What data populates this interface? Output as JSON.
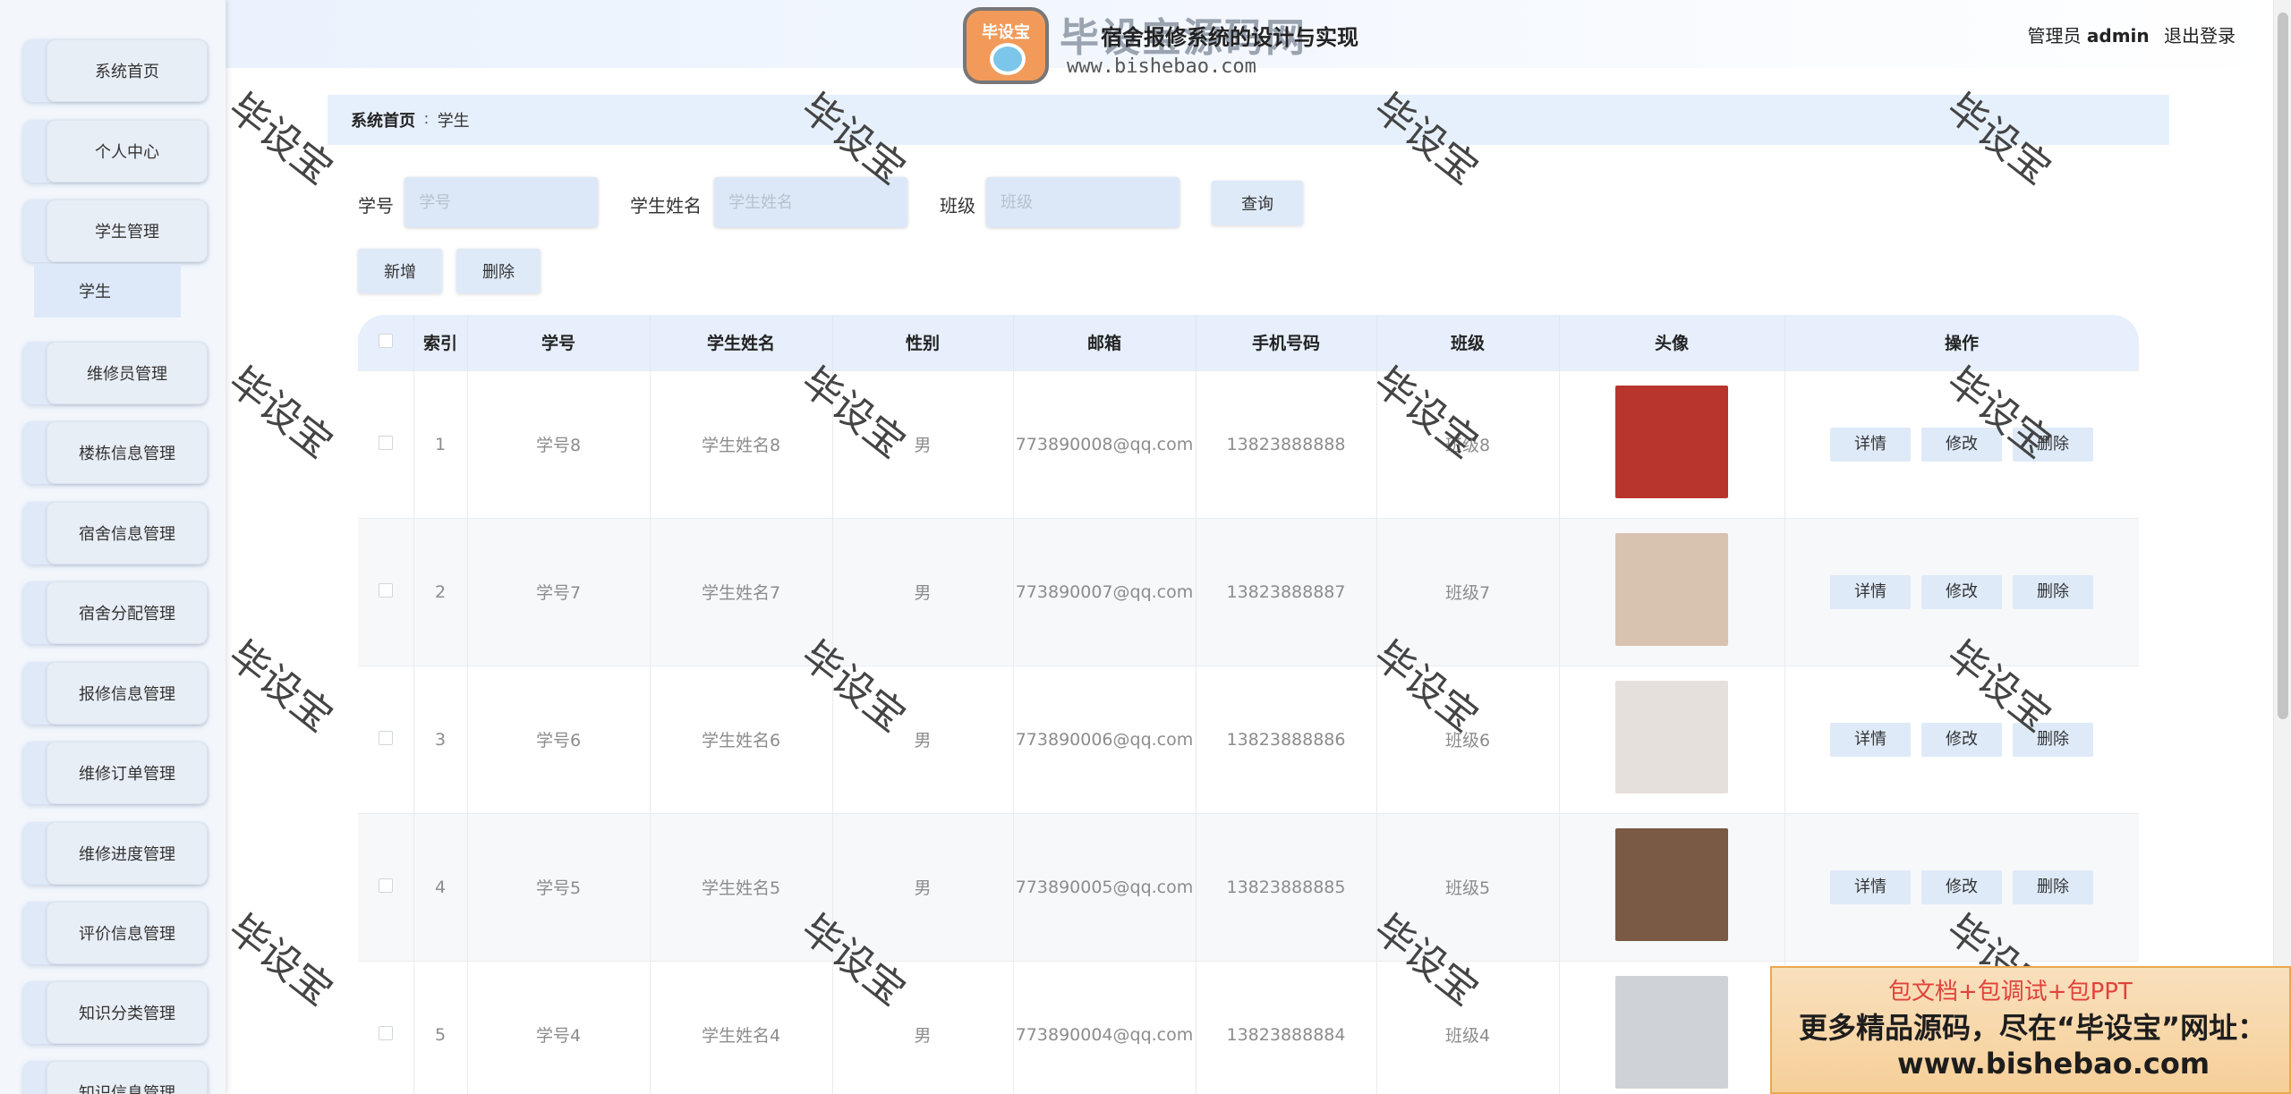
{
  "app": {
    "title": "宿舍报修系统的设计与实现",
    "role": "管理员",
    "username": "admin",
    "logout_label": "退出登录"
  },
  "logo": {
    "badge_text": "毕设宝",
    "name": "毕设宝源码网",
    "url": "www.bishebao.com"
  },
  "sidebar": {
    "items": [
      {
        "label": "系统首页"
      },
      {
        "label": "个人中心"
      },
      {
        "label": "学生管理"
      },
      {
        "label": "维修员管理"
      },
      {
        "label": "楼栋信息管理"
      },
      {
        "label": "宿舍信息管理"
      },
      {
        "label": "宿舍分配管理"
      },
      {
        "label": "报修信息管理"
      },
      {
        "label": "维修订单管理"
      },
      {
        "label": "维修进度管理"
      },
      {
        "label": "评价信息管理"
      },
      {
        "label": "知识分类管理"
      },
      {
        "label": "知识信息管理"
      }
    ],
    "submenu": {
      "label": "学生"
    }
  },
  "breadcrumb": {
    "home": "系统首页",
    "separator": "∶",
    "current": "学生"
  },
  "search": {
    "fields": [
      {
        "label": "学号",
        "placeholder": "学号"
      },
      {
        "label": "学生姓名",
        "placeholder": "学生姓名"
      },
      {
        "label": "班级",
        "placeholder": "班级"
      }
    ],
    "query_label": "查询"
  },
  "toolbar": {
    "add_label": "新增",
    "delete_label": "删除"
  },
  "table": {
    "columns": [
      "",
      "索引",
      "学号",
      "学生姓名",
      "性别",
      "邮箱",
      "手机号码",
      "班级",
      "头像",
      "操作"
    ],
    "actions": {
      "detail": "详情",
      "edit": "修改",
      "delete": "删除"
    },
    "rows": [
      {
        "index": "1",
        "student_no": "学号8",
        "name": "学生姓名8",
        "gender": "男",
        "email": "773890008@qq.com",
        "phone": "13823888888",
        "class": "班级8",
        "avatar_color": "#b8352e"
      },
      {
        "index": "2",
        "student_no": "学号7",
        "name": "学生姓名7",
        "gender": "男",
        "email": "773890007@qq.com",
        "phone": "13823888887",
        "class": "班级7",
        "avatar_color": "#d8c2b0"
      },
      {
        "index": "3",
        "student_no": "学号6",
        "name": "学生姓名6",
        "gender": "男",
        "email": "773890006@qq.com",
        "phone": "13823888886",
        "class": "班级6",
        "avatar_color": "#e6e0dc"
      },
      {
        "index": "4",
        "student_no": "学号5",
        "name": "学生姓名5",
        "gender": "男",
        "email": "773890005@qq.com",
        "phone": "13823888885",
        "class": "班级5",
        "avatar_color": "#7a5a44"
      },
      {
        "index": "5",
        "student_no": "学号4",
        "name": "学生姓名4",
        "gender": "男",
        "email": "773890004@qq.com",
        "phone": "13823888884",
        "class": "班级4",
        "avatar_color": "#cfd2d6"
      }
    ]
  },
  "watermark": {
    "text": "毕设宝"
  },
  "ad": {
    "line1": "包文档+包调试+包PPT",
    "line2": "更多精品源码，尽在“毕设宝”网址：",
    "line3": "www.bishebao.com"
  }
}
